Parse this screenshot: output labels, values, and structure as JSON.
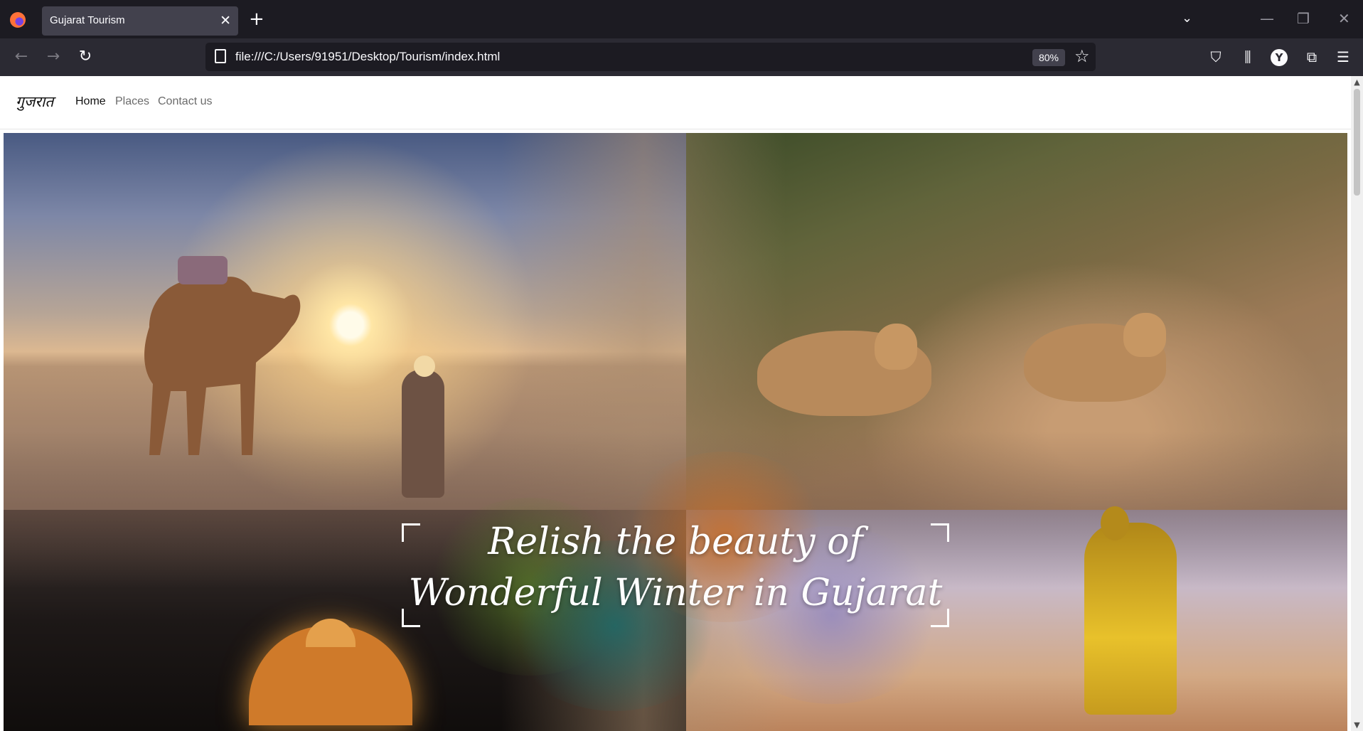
{
  "browser": {
    "tab_title": "Gujarat Tourism",
    "url": "file:///C:/Users/91951/Desktop/Tourism/index.html",
    "zoom": "80%",
    "profile_badge": "Y",
    "icons": {
      "close": "✕",
      "new_tab": "+",
      "tab_list": "⌄",
      "minimize": "—",
      "restore": "❐",
      "window_close": "✕",
      "back": "←",
      "forward": "→",
      "reload": "↻",
      "star": "☆",
      "pocket": "⛉",
      "library": "⫼",
      "extensions": "⧉",
      "menu": "☰"
    }
  },
  "site": {
    "brand": "गुजरात",
    "nav": [
      {
        "label": "Home"
      },
      {
        "label": "Places"
      },
      {
        "label": "Contact us"
      }
    ],
    "hero": {
      "tagline_line1": "Relish the beauty of",
      "tagline_line2": "Wonderful Winter in Gujarat"
    }
  }
}
